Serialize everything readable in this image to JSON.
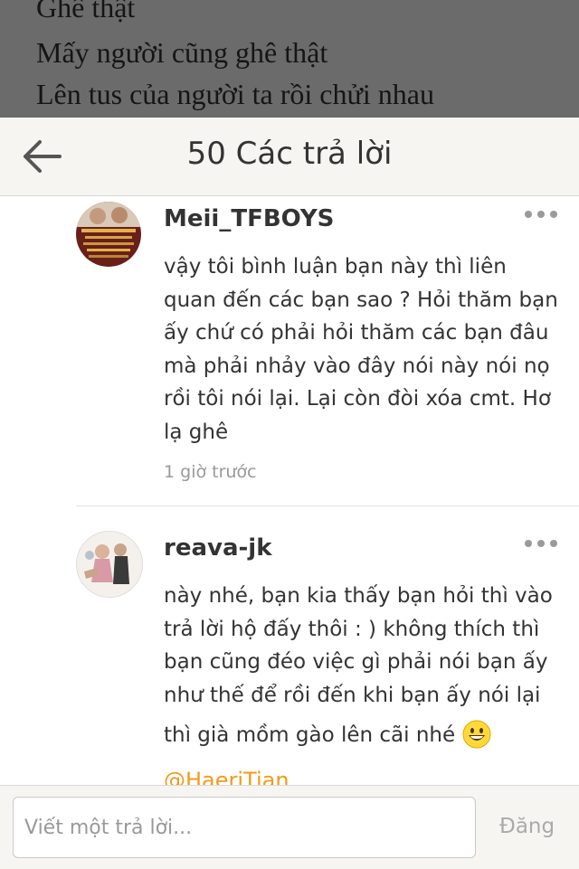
{
  "background_post": {
    "lines": [
      "Ghê thật",
      "Mấy người cũng ghê thật",
      "Lên tus của người ta rồi chửi nhau"
    ]
  },
  "header": {
    "back_icon": "arrow-left-icon",
    "title": "50 Các trả lời"
  },
  "comments": [
    {
      "username": "Meii_TFBOYS",
      "text_lines": [
        "vậy tôi bình luận bạn này thì liên",
        "quan đến các bạn sao ? Hỏi thăm bạn",
        "ấy chứ có phải hỏi thăm các bạn đâu",
        "mà phải nhảy vào đây nói này nói nọ",
        "rồi tôi nói lại. Lại còn đòi xóa cmt. Hơ",
        "lạ ghê"
      ],
      "timestamp": "1 giờ trước"
    },
    {
      "username": "reava-jk",
      "text_lines": [
        "này nhé, bạn kia thấy bạn hỏi thì vào",
        "trả lời hộ đấy thôi : ) không thích thì",
        "bạn cũng đéo việc gì phải nói bạn ấy",
        "như thế để rồi đến khi bạn ấy nói lại",
        "thì già mồm gào lên cãi nhé"
      ],
      "emoji": "grinning-face-icon",
      "mention": "@HaeriTian"
    }
  ],
  "reply_bar": {
    "placeholder": "Viết một trả lời...",
    "post_label": "Đăng"
  },
  "colors": {
    "accent": "#f29a1b",
    "header_bg": "#f6f5f1",
    "overlay": "#6b6b6b"
  }
}
